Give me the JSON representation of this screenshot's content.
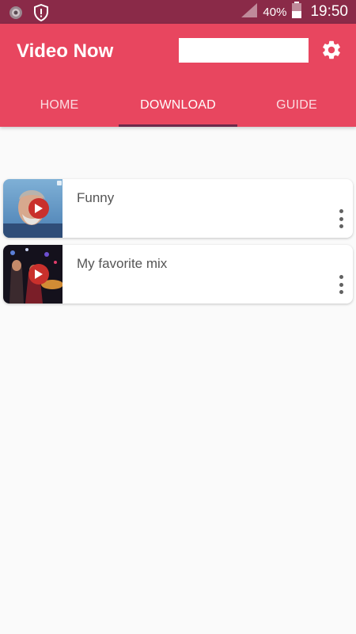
{
  "status_bar": {
    "battery_percent": "40%",
    "time": "19:50",
    "icons": [
      "camera-notification-icon",
      "shield-alert-icon",
      "signal-icon",
      "battery-icon"
    ]
  },
  "app_bar": {
    "title": "Video Now",
    "search": {
      "value": "",
      "placeholder": ""
    },
    "settings_icon": "gear-icon",
    "color": "#e8465f"
  },
  "tabs": [
    {
      "label": "HOME",
      "active": false
    },
    {
      "label": "DOWNLOAD",
      "active": true
    },
    {
      "label": "GUIDE",
      "active": false
    }
  ],
  "playlists": [
    {
      "title": "Funny",
      "thumbnail": "man-portrait-thumbnail",
      "play_icon": "play-icon",
      "menu_icon": "more-vertical-icon"
    },
    {
      "title": "My favorite mix",
      "thumbnail": "concert-crowd-thumbnail",
      "play_icon": "play-icon",
      "menu_icon": "more-vertical-icon"
    }
  ],
  "colors": {
    "status_bar": "#8a2a48",
    "accent": "#e8465f",
    "tab_indicator": "#6b2a4a",
    "background": "#fafafa"
  }
}
